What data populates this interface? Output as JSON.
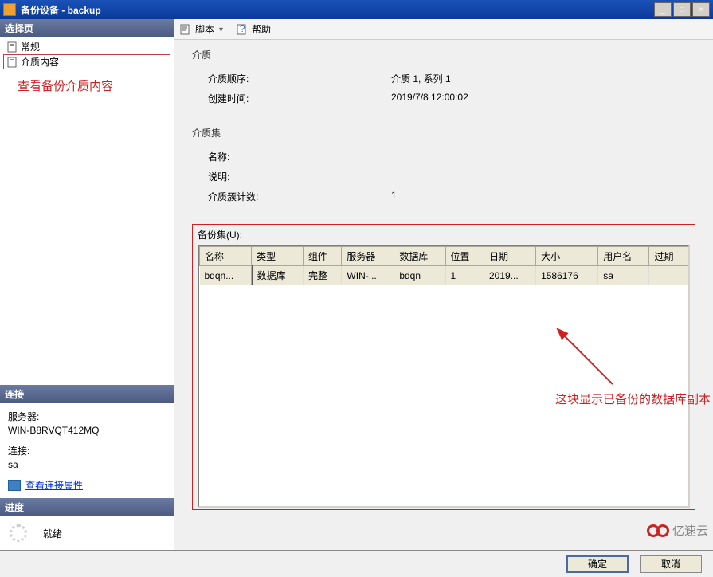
{
  "titlebar": {
    "text": "备份设备 - backup"
  },
  "sidebar": {
    "select_page": "选择页",
    "tree": [
      {
        "label": "常规",
        "selected": false
      },
      {
        "label": "介质内容",
        "selected": true
      }
    ],
    "annotation": "查看备份介质内容",
    "connection": {
      "header": "连接",
      "server_label": "服务器:",
      "server_value": "WIN-B8RVQT412MQ",
      "conn_label": "连接:",
      "conn_value": "sa",
      "link": "查看连接属性"
    },
    "progress": {
      "header": "进度",
      "status": "就绪"
    }
  },
  "toolbar": {
    "script": "脚本",
    "help": "帮助"
  },
  "content": {
    "media": {
      "legend": "介质",
      "seq_label": "介质顺序:",
      "seq_value": "介质 1, 系列 1",
      "created_label": "创建时间:",
      "created_value": "2019/7/8 12:00:02"
    },
    "mediaset": {
      "legend": "介质集",
      "name_label": "名称:",
      "name_value": "",
      "desc_label": "说明:",
      "desc_value": "",
      "family_label": "介质簇计数:",
      "family_value": "1"
    },
    "backupset": {
      "label": "备份集(U):",
      "columns": [
        "名称",
        "类型",
        "组件",
        "服务器",
        "数据库",
        "位置",
        "日期",
        "大小",
        "用户名",
        "过期"
      ],
      "rows": [
        {
          "name": "bdqn...",
          "type": "数据库",
          "component": "完整",
          "server": "WIN-...",
          "database": "bdqn",
          "position": "1",
          "date": "2019...",
          "size": "1586176",
          "user": "sa",
          "expire": ""
        }
      ]
    },
    "annotation": "这块显示已备份的数据库副本"
  },
  "footer": {
    "ok": "确定",
    "cancel": "取消"
  },
  "watermark": "亿速云"
}
